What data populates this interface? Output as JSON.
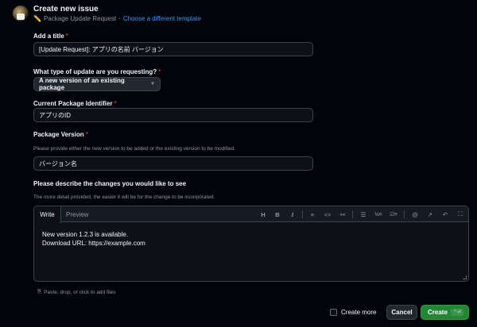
{
  "header": {
    "title": "Create new issue",
    "template_name": "Package Update Request",
    "separator": "·",
    "change_template_link": "Choose a different template"
  },
  "form": {
    "title_field": {
      "label": "Add a title",
      "required_mark": "*",
      "value": "[Update Request]: アプリの名前 バージョン"
    },
    "update_type": {
      "label": "What type of update are you requesting?",
      "required_mark": "*",
      "selected": "A new version of an existing package"
    },
    "package_identifier": {
      "label": "Current Package Identifier",
      "required_mark": "*",
      "value": "アプリのID"
    },
    "package_version": {
      "label": "Package Version",
      "required_mark": "*",
      "hint": "Please provide either the new version to be added or the existing version to be modified.",
      "value": "バージョン名"
    },
    "description": {
      "label": "Please describe the changes you would like to see",
      "hint": "The more detail provided, the easier it will be for the change to be incorporated.",
      "tabs": [
        "Write",
        "Preview"
      ],
      "body_lines": [
        "New version 1.2.3 is available.",
        "Download URL: https://example.com"
      ]
    },
    "attach_hint": "Paste, drop, or click to add files"
  },
  "footer": {
    "create_more_label": "Create more",
    "cancel_label": "Cancel",
    "create_label": "Create"
  },
  "icons": {
    "toolbar": [
      "heading-icon",
      "bold-icon",
      "italic-icon",
      "quote-icon",
      "code-icon",
      "link-icon",
      "unordered-list-icon",
      "ordered-list-icon",
      "task-list-icon",
      "mention-icon",
      "reference-icon",
      "undo-icon",
      "fullscreen-icon"
    ]
  },
  "colors": {
    "accent": "#4493f8",
    "primary_button": "#238636",
    "required": "#f85149",
    "background": "#010409"
  }
}
